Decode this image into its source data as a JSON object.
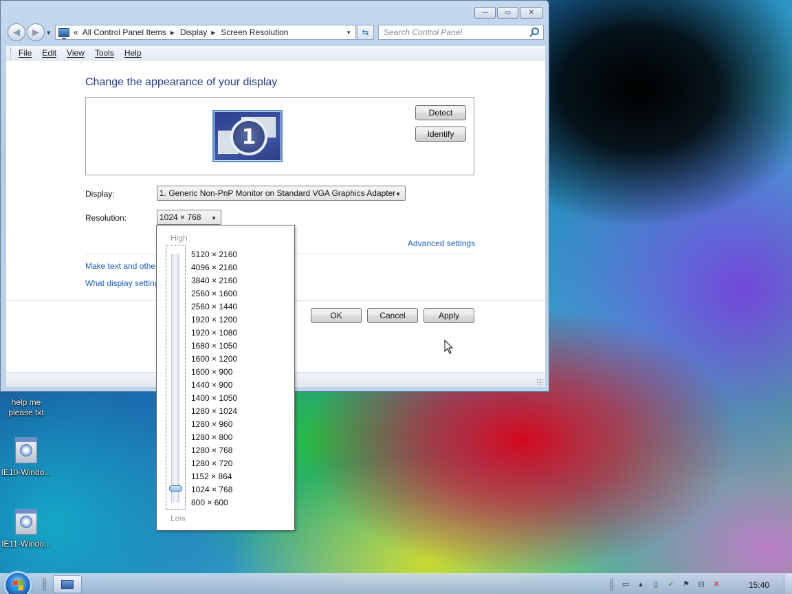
{
  "desktop": {
    "icons": [
      {
        "label_line1": "help me",
        "label_line2": "please.txt"
      },
      {
        "label": "IE10-Windo..."
      },
      {
        "label": "IE11-Windo..."
      }
    ]
  },
  "window": {
    "controls": {
      "minimize": "—",
      "maximize": "▭",
      "close": "✕"
    },
    "address": {
      "overflow": "«",
      "segments": [
        "All Control Panel Items",
        "Display",
        "Screen Resolution"
      ],
      "separator": "▶"
    },
    "search": {
      "placeholder": "Search Control Panel"
    },
    "menu": [
      "File",
      "Edit",
      "View",
      "Tools",
      "Help"
    ],
    "page_title": "Change the appearance of your display",
    "monitor_number": "1",
    "buttons": {
      "detect": "Detect",
      "identify": "Identify",
      "ok": "OK",
      "cancel": "Cancel",
      "apply": "Apply"
    },
    "display_label": "Display:",
    "display_value": "1. Generic Non-PnP Monitor on Standard VGA Graphics Adapter",
    "resolution_label": "Resolution:",
    "resolution_value": "1024 × 768",
    "advanced_link": "Advanced settings",
    "link_text_size": "Make text and other",
    "link_display_settings": "What display setting"
  },
  "resolution_popup": {
    "high_label": "High",
    "low_label": "Low",
    "options": [
      "5120 × 2160",
      "4096 × 2160",
      "3840 × 2160",
      "2560 × 1600",
      "2560 × 1440",
      "1920 × 1200",
      "1920 × 1080",
      "1680 × 1050",
      "1600 × 1200",
      "1600 × 900",
      "1440 × 900",
      "1400 × 1050",
      "1280 × 1024",
      "1280 × 960",
      "1280 × 800",
      "1280 × 768",
      "1280 × 720",
      "1152 × 864",
      "1024 × 768",
      "800 × 600"
    ],
    "selected": "1024 × 768"
  },
  "taskbar": {
    "clock": "15:40",
    "tray_icons": [
      "monitor-icon",
      "chevron-icon",
      "document-icon",
      "checkmark-icon",
      "flag-icon",
      "network-icon",
      "volume-muted-icon"
    ]
  },
  "colors": {
    "link": "#1b5fbf",
    "title": "#1e3d8a"
  }
}
